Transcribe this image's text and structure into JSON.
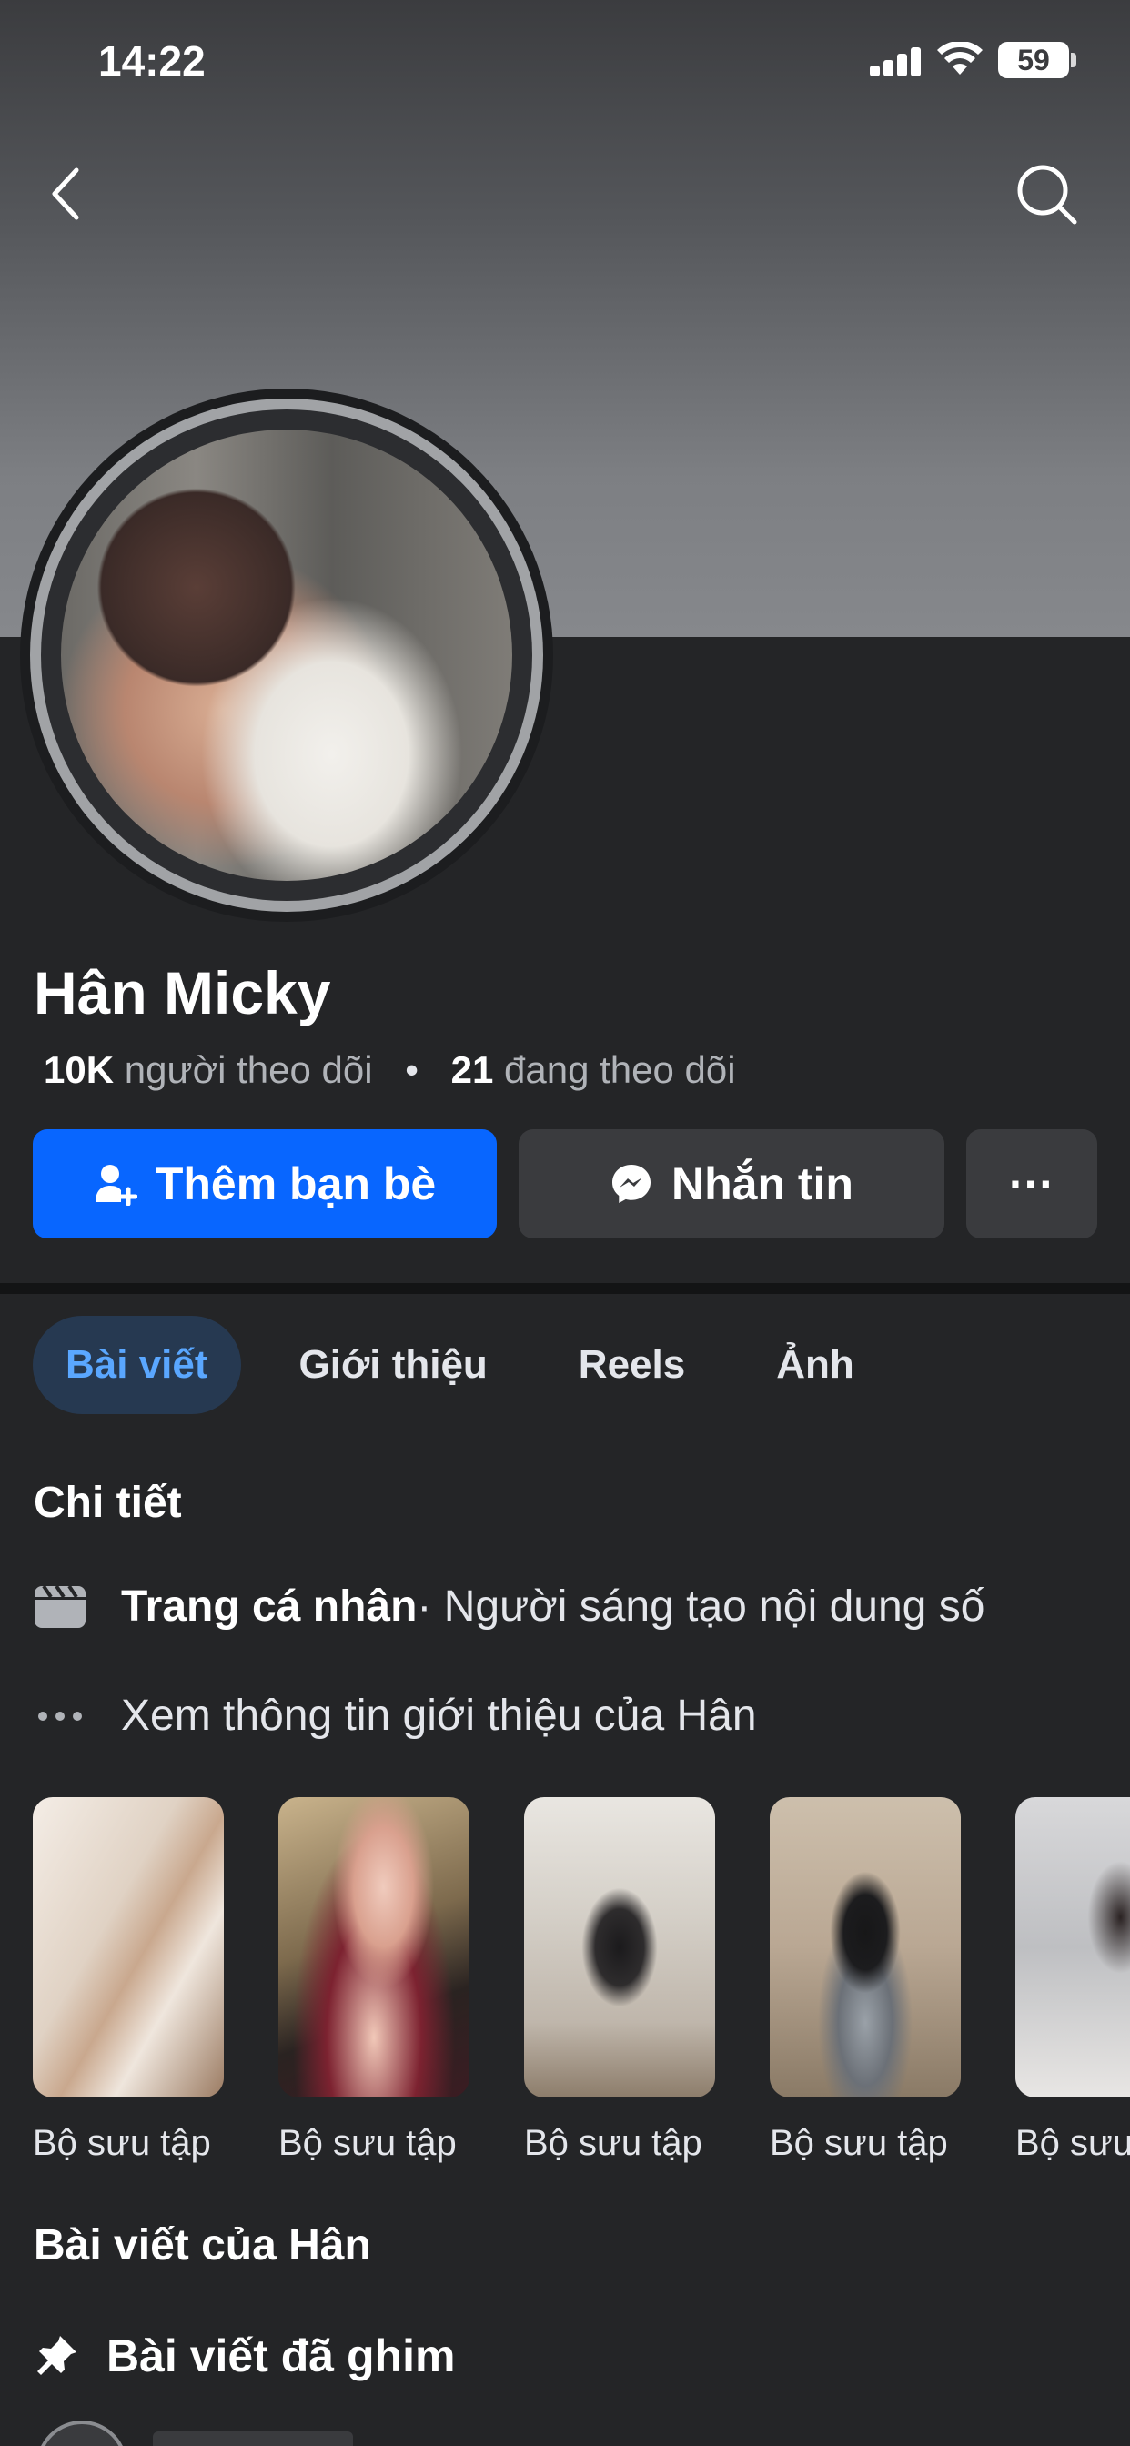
{
  "status_bar": {
    "time": "14:22",
    "battery": "59",
    "icons": [
      "signal-icon",
      "wifi-icon",
      "battery-icon"
    ]
  },
  "header": {
    "icons": [
      "chevron-left-icon",
      "search-icon"
    ]
  },
  "profile": {
    "name": "Hân Micky",
    "followers_count": "10K",
    "followers_label": "người theo dõi",
    "following_count": "21",
    "following_label": "đang theo dõi"
  },
  "actions": {
    "add_friend_label": "Thêm bạn bè",
    "message_label": "Nhắn tin",
    "more_label": "···"
  },
  "tabs": [
    {
      "label": "Bài viết",
      "active": true
    },
    {
      "label": "Giới thiệu",
      "active": false
    },
    {
      "label": "Reels",
      "active": false
    },
    {
      "label": "Ảnh",
      "active": false
    }
  ],
  "details": {
    "title": "Chi tiết",
    "page_type_label": "Trang cá nhân",
    "page_category": " · Người sáng tạo nội dung số",
    "see_about": "Xem thông tin giới thiệu của Hân"
  },
  "collections": [
    {
      "label": "Bộ sưu tập"
    },
    {
      "label": "Bộ sưu tập"
    },
    {
      "label": "Bộ sưu tập"
    },
    {
      "label": "Bộ sưu tập"
    },
    {
      "label": "Bộ sưu tập"
    }
  ],
  "posts": {
    "title": "Bài viết của Hân",
    "pinned_label": "Bài viết đã ghim"
  },
  "colors": {
    "background": "#242527",
    "primary_button": "#0866ff",
    "secondary_button": "#3a3b3e",
    "active_tab_bg": "#263951",
    "active_tab_text": "#5aa7ff"
  }
}
